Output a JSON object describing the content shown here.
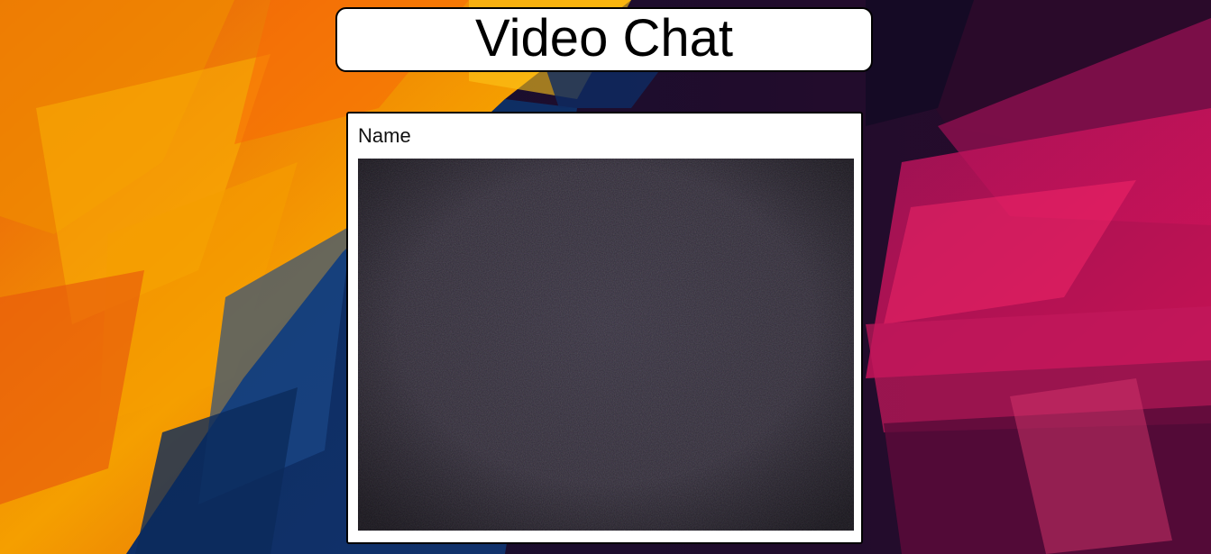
{
  "page": {
    "title": "Video Chat"
  },
  "participant": {
    "name": "Name"
  },
  "colors": {
    "title_bg": "#ffffff",
    "card_bg": "#ffffff",
    "border": "#000000",
    "video_bg": "#2f2a35"
  }
}
